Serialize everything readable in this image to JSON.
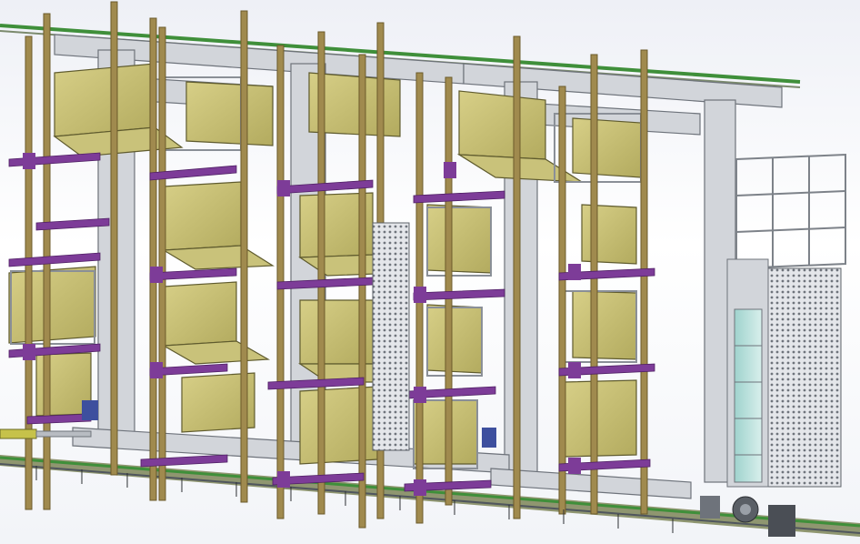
{
  "viewport": {
    "description_visible_text": ""
  },
  "colors": {
    "background_top": "#eef0f6",
    "rail_green": "#3f8f3a",
    "frame_gray": "#c9ccd2",
    "frame_dark": "#6e737b",
    "post_brown": "#a08a4e",
    "clamp_purple": "#7d3c98",
    "seat_olive": "#c9c27a",
    "seat_dark": "#a59d55",
    "glass_cyan": "#bfe3e0"
  },
  "icons": {
    "model": "cad-assembly-icon"
  }
}
